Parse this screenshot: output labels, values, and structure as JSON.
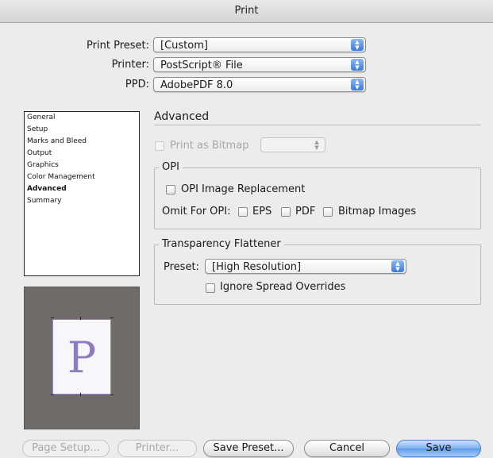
{
  "window": {
    "title": "Print"
  },
  "header": {
    "preset_label": "Print Preset:",
    "preset_value": "[Custom]",
    "printer_label": "Printer:",
    "printer_value": "PostScript® File",
    "ppd_label": "PPD:",
    "ppd_value": "AdobePDF 8.0"
  },
  "sidebar": {
    "items": [
      {
        "label": "General"
      },
      {
        "label": "Setup"
      },
      {
        "label": "Marks and Bleed"
      },
      {
        "label": "Output"
      },
      {
        "label": "Graphics"
      },
      {
        "label": "Color Management"
      },
      {
        "label": "Advanced"
      },
      {
        "label": "Summary"
      }
    ],
    "selected": "Advanced"
  },
  "preview": {
    "letter": "P"
  },
  "advanced": {
    "title": "Advanced",
    "print_as_bitmap_label": "Print as Bitmap",
    "print_as_bitmap_checked": false,
    "opi": {
      "title": "OPI",
      "image_replacement_label": "OPI Image Replacement",
      "omit_label": "Omit For OPI:",
      "eps_label": "EPS",
      "pdf_label": "PDF",
      "bitmap_label": "Bitmap Images"
    },
    "flattener": {
      "title": "Transparency Flattener",
      "preset_label": "Preset:",
      "preset_value": "[High Resolution]",
      "ignore_label": "Ignore Spread Overrides"
    }
  },
  "buttons": {
    "page_setup": "Page Setup...",
    "printer": "Printer...",
    "save_preset": "Save Preset...",
    "cancel": "Cancel",
    "save": "Save"
  }
}
